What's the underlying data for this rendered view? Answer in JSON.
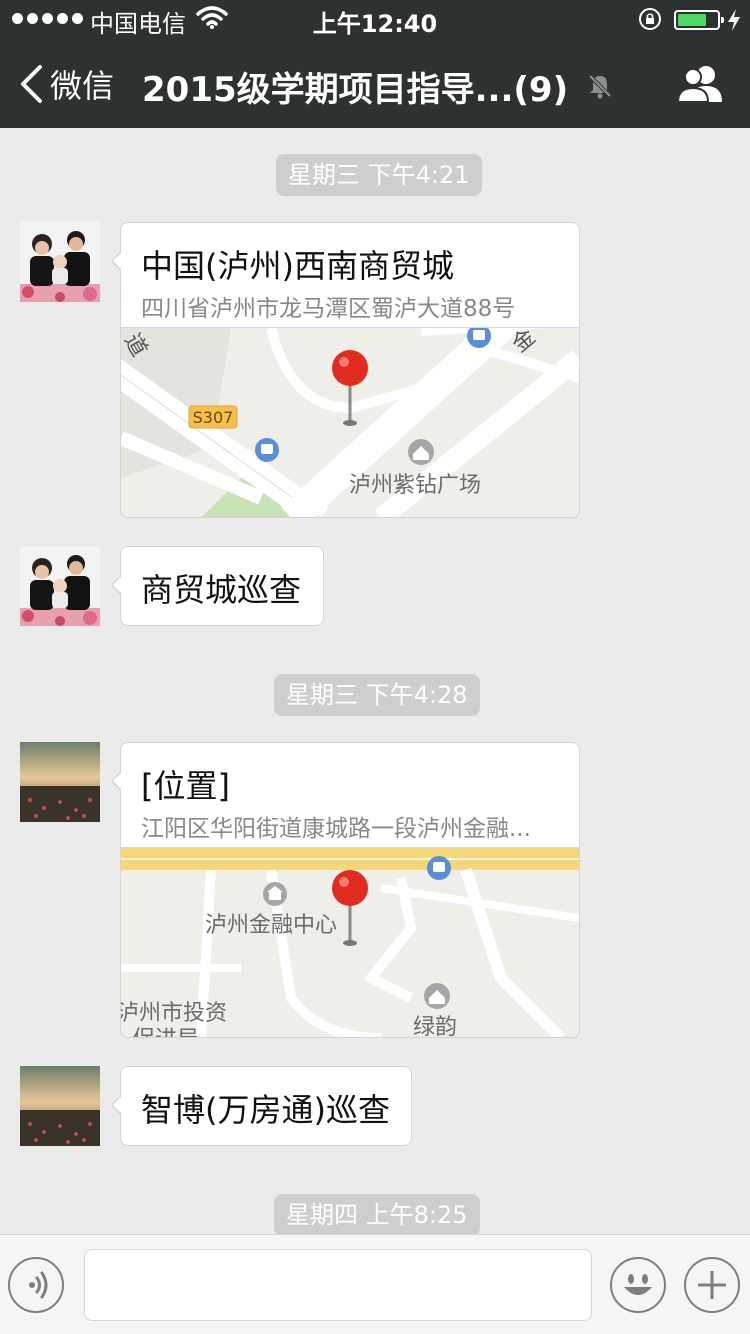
{
  "status": {
    "carrier": "中国电信",
    "time": "上午12:40"
  },
  "nav": {
    "back_label": "微信",
    "title": "2015级学期项目指导...(9)"
  },
  "messages": [
    {
      "kind": "time",
      "text": "星期三 下午4:21"
    },
    {
      "kind": "location",
      "name": "中国(泸州)西南商贸城",
      "address": "四川省泸州市龙马潭区蜀泸大道88号",
      "map": {
        "road": "S307",
        "poi": "泸州紫钻广场",
        "edge_top_left": "道",
        "edge_top_right": "金"
      }
    },
    {
      "kind": "text",
      "text": "商贸城巡查"
    },
    {
      "kind": "time",
      "text": "星期三 下午4:28"
    },
    {
      "kind": "location",
      "name": "[位置]",
      "address": "江阳区华阳街道康城路一段泸州金融...",
      "map": {
        "poi": "泸州金融中心",
        "poi2": "绿韵",
        "poi3": "泸州市投资",
        "poi3_line2": "促进局"
      }
    },
    {
      "kind": "text",
      "text": "智博(万房通)巡查"
    },
    {
      "kind": "time",
      "text": "星期四 上午8:25"
    }
  ],
  "colors": {
    "nav_bg": "#2e3132",
    "chat_bg": "#ebebeb",
    "time_badge": "#cecece",
    "pin": "#e02b20",
    "road_yellow": "#f5d77a",
    "battery": "#4cd964"
  },
  "icons": [
    "wifi-icon",
    "lock-rotation-icon",
    "battery-icon",
    "charging-icon",
    "back-chevron-icon",
    "mute-icon",
    "members-icon",
    "voice-icon",
    "emoji-icon",
    "plus-icon",
    "map-pin-icon",
    "bus-stop-icon",
    "home-poi-icon",
    "bank-poi-icon"
  ]
}
